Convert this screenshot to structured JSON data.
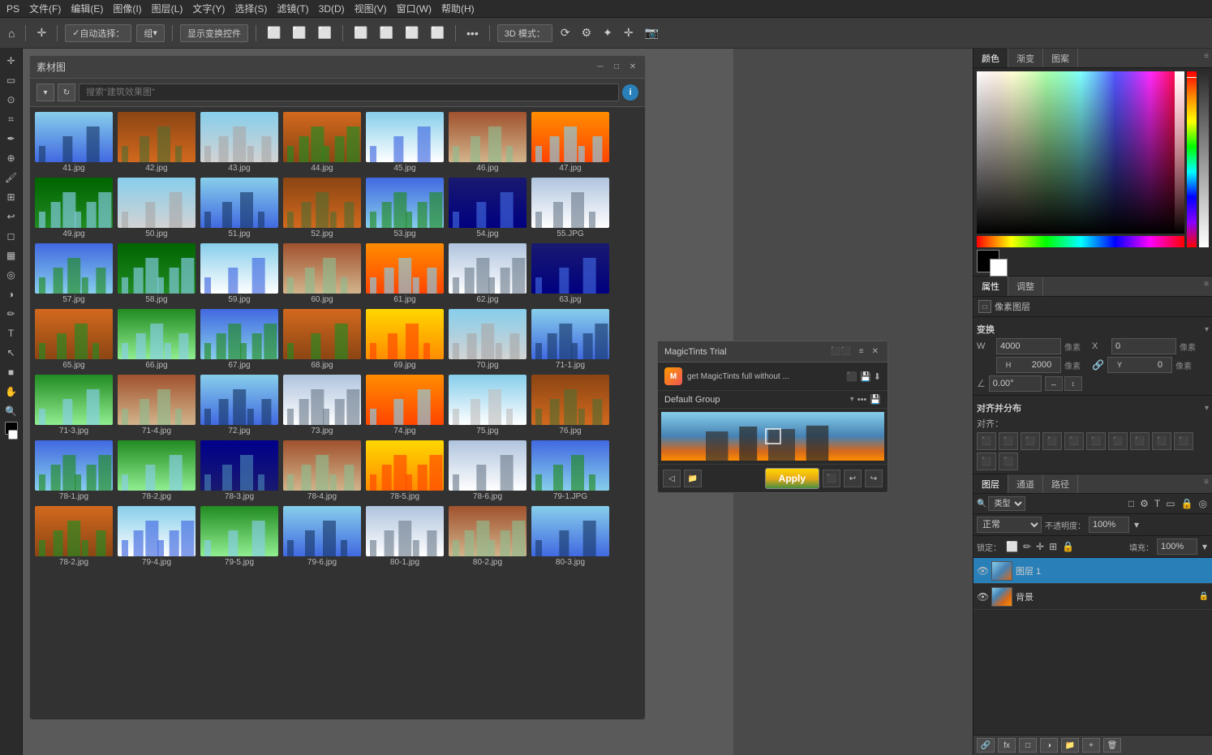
{
  "app": {
    "title": "素材图",
    "menu": [
      "PS",
      "文件(F)",
      "编辑(E)",
      "图像(I)",
      "图层(L)",
      "文字(Y)",
      "选择(S)",
      "滤镜(T)",
      "3D(D)",
      "视图(V)",
      "窗口(W)",
      "帮助(H)"
    ]
  },
  "toolbar": {
    "auto_select_label": "自动选择：",
    "group_label": "组",
    "transform_label": "显示变换控件",
    "mode_3d": "3D 模式：",
    "more_icon": "•••"
  },
  "search": {
    "placeholder": "搜索\"建筑效果图\"",
    "refresh_icon": "↻",
    "info_icon": "i"
  },
  "images": [
    {
      "name": "41.jpg",
      "color": "img-blue"
    },
    {
      "name": "42.jpg",
      "color": "img-warm"
    },
    {
      "name": "43.jpg",
      "color": "img-city"
    },
    {
      "name": "44.jpg",
      "color": "img-warm"
    },
    {
      "name": "45.jpg",
      "color": "img-blue"
    },
    {
      "name": "46.jpg",
      "color": "img-warm"
    },
    {
      "name": "47.jpg",
      "color": "img-sunset"
    },
    {
      "name": "49.jpg",
      "color": "img-green"
    },
    {
      "name": "50.jpg",
      "color": "img-city"
    },
    {
      "name": "51.jpg",
      "color": "img-blue"
    },
    {
      "name": "52.jpg",
      "color": "img-warm"
    },
    {
      "name": "53.jpg",
      "color": "img-blue"
    },
    {
      "name": "54.jpg",
      "color": "img-night"
    },
    {
      "name": "55.JPG",
      "color": "img-city"
    },
    {
      "name": "57.jpg",
      "color": "img-blue"
    },
    {
      "name": "58.jpg",
      "color": "img-green"
    },
    {
      "name": "59.jpg",
      "color": "img-blue"
    },
    {
      "name": "60.jpg",
      "color": "img-warm"
    },
    {
      "name": "61.jpg",
      "color": "img-sunset"
    },
    {
      "name": "62.jpg",
      "color": "img-city"
    },
    {
      "name": "63.jpg",
      "color": "img-night"
    },
    {
      "name": "65.jpg",
      "color": "img-warm"
    },
    {
      "name": "66.jpg",
      "color": "img-green"
    },
    {
      "name": "67.jpg",
      "color": "img-blue"
    },
    {
      "name": "68.jpg",
      "color": "img-warm"
    },
    {
      "name": "69.jpg",
      "color": "img-sunset"
    },
    {
      "name": "70.jpg",
      "color": "img-city"
    },
    {
      "name": "71-1.jpg",
      "color": "img-blue"
    },
    {
      "name": "71-3.jpg",
      "color": "img-green"
    },
    {
      "name": "71-4.jpg",
      "color": "img-warm"
    },
    {
      "name": "72.jpg",
      "color": "img-blue"
    },
    {
      "name": "73.jpg",
      "color": "img-city"
    },
    {
      "name": "74.jpg",
      "color": "img-sunset"
    },
    {
      "name": "75.jpg",
      "color": "img-city"
    },
    {
      "name": "76.jpg",
      "color": "img-warm"
    },
    {
      "name": "78-1.jpg",
      "color": "img-blue"
    },
    {
      "name": "78-2.jpg",
      "color": "img-green"
    },
    {
      "name": "78-3.jpg",
      "color": "img-night"
    },
    {
      "name": "78-4.jpg",
      "color": "img-warm"
    },
    {
      "name": "78-5.jpg",
      "color": "img-sunset"
    },
    {
      "name": "78-6.jpg",
      "color": "img-city"
    },
    {
      "name": "79-1.JPG",
      "color": "img-blue"
    },
    {
      "name": "78-2.jpg",
      "color": "img-warm"
    },
    {
      "name": "79-4.jpg",
      "color": "img-blue"
    },
    {
      "name": "79-5.jpg",
      "color": "img-green"
    },
    {
      "name": "79-6.jpg",
      "color": "img-blue"
    },
    {
      "name": "80-1.jpg",
      "color": "img-city"
    },
    {
      "name": "80-2.jpg",
      "color": "img-warm"
    },
    {
      "name": "80-3.jpg",
      "color": "img-blue"
    }
  ],
  "right_panel": {
    "tabs": [
      "颜色",
      "渐变",
      "图案"
    ],
    "color_icon": "■"
  },
  "properties": {
    "title": "属性",
    "adjust_label": "调整",
    "layer_type": "像素图层",
    "transform_title": "变换",
    "W_label": "W",
    "W_value": "4000",
    "W_unit": "像素",
    "X_label": "X",
    "X_value": "0",
    "X_unit": "像素",
    "H_label": "H",
    "H_value": "2000",
    "H_unit": "像素",
    "Y_label": "Y",
    "Y_value": "0",
    "Y_unit": "像素",
    "angle_value": "0.00°",
    "align_title": "对齐并分布",
    "align_label": "对齐："
  },
  "layers": {
    "tabs": [
      "图层",
      "通道",
      "路径"
    ],
    "filter_label": "类型",
    "blend_mode": "正常",
    "opacity_label": "不透明度：",
    "opacity_value": "100%",
    "fill_label": "填充：",
    "fill_value": "100%",
    "lock_label": "锁定：",
    "layer1_name": "图层 1",
    "layer2_name": "背景",
    "bottom_btns": [
      "⊞",
      "fx",
      "□",
      "🗑",
      "□",
      "↻"
    ]
  },
  "magic_tints": {
    "title": "MagicTints Trial",
    "upgrade_text": "get MagicTints full without ...",
    "group_label": "Default Group",
    "apply_label": "Apply"
  }
}
